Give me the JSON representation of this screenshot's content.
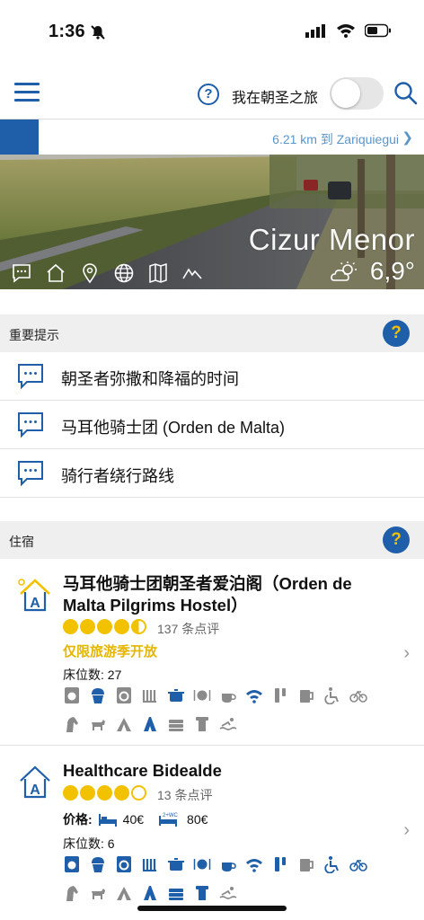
{
  "status": {
    "time": "1:36"
  },
  "header": {
    "pilgrim_label": "我在朝圣之旅",
    "help_symbol": "?"
  },
  "distance": {
    "text": "6.21 km 到 Zariquiegui"
  },
  "hero": {
    "town": "Cizur Menor",
    "temperature": "6,9°"
  },
  "notices": {
    "title": "重要提示",
    "help_symbol": "?",
    "items": [
      {
        "label": "朝圣者弥撒和降福的时间"
      },
      {
        "label": "马耳他骑士团 (Orden de Malta)"
      },
      {
        "label": "骑行者绕行路线"
      }
    ]
  },
  "lodging": {
    "title": "住宿",
    "help_symbol": "?",
    "items": [
      {
        "name_line1": "马耳他骑士团朝圣者爱泊阁（Orden de",
        "name_line2": "Malta Pilgrims Hostel）",
        "rating": 4.5,
        "reviews": "137 条点评",
        "season": "仅限旅游季开放",
        "beds": "床位数: 27"
      },
      {
        "name": "Healthcare Bidealde",
        "rating": 4,
        "reviews": "13 条点评",
        "price_label": "价格:",
        "price_bed": "40€",
        "price_room": "80€",
        "beds": "床位数: 6"
      }
    ]
  },
  "colors": {
    "brand_blue": "#1f5ea8",
    "accent_yellow": "#f2c200",
    "link_blue": "#5a95c9"
  }
}
